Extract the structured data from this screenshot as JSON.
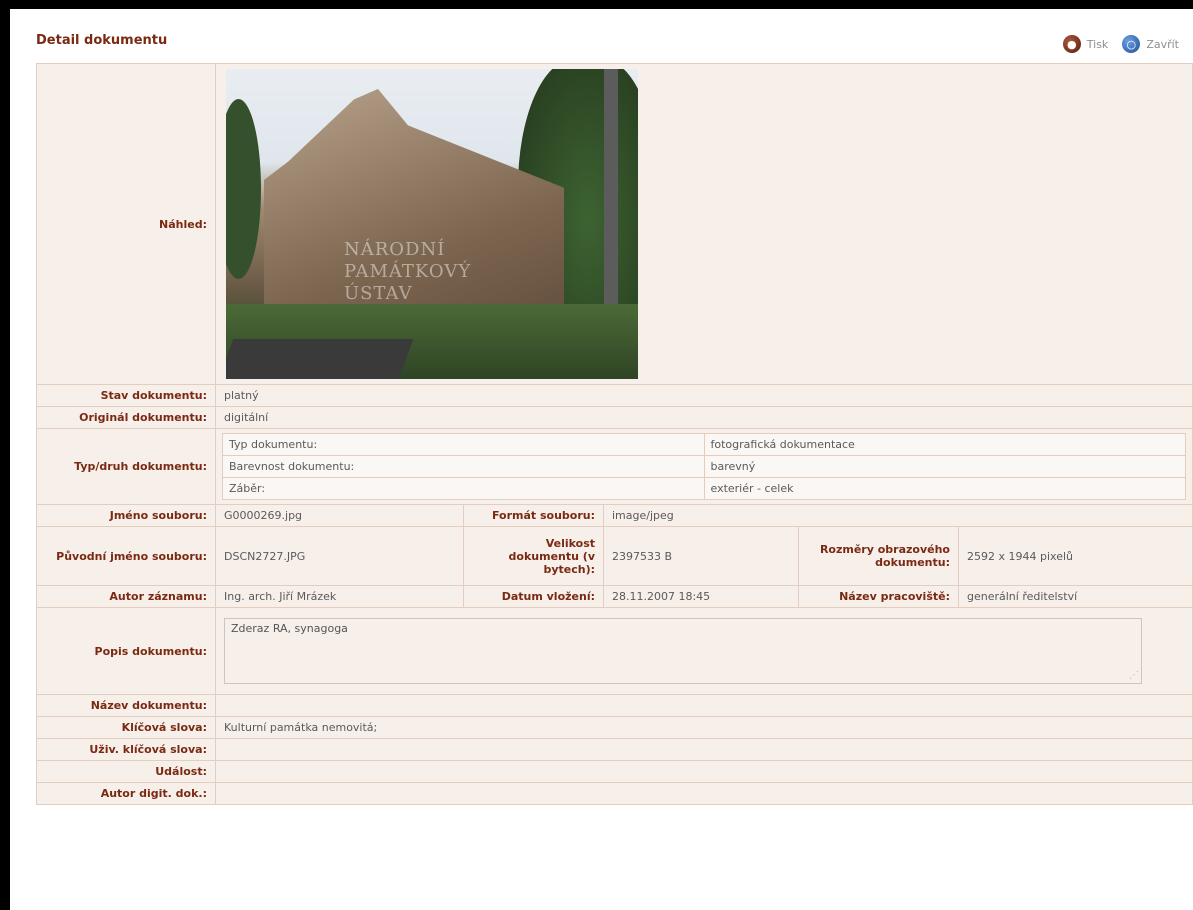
{
  "header": {
    "title": "Detail dokumentu",
    "print_label": "Tisk",
    "close_label": "Zavřít"
  },
  "preview": {
    "label": "Náhled:",
    "watermark": [
      "NÁRODNÍ",
      "PAMÁTKOVÝ",
      "ÚSTAV"
    ]
  },
  "rows": {
    "stav": {
      "label": "Stav dokumentu:",
      "value": "platný"
    },
    "original": {
      "label": "Originál dokumentu:",
      "value": "digitální"
    },
    "typ": {
      "label": "Typ/druh dokumentu:",
      "items": [
        {
          "key": "Typ dokumentu:",
          "value": "fotografická dokumentace"
        },
        {
          "key": "Barevnost dokumentu:",
          "value": "barevný"
        },
        {
          "key": "Záběr:",
          "value": "exteriér - celek"
        }
      ]
    },
    "jmeno": {
      "label": "Jméno souboru:",
      "value": "G0000269.jpg",
      "format_label": "Formát souboru:",
      "format_value": "image/jpeg"
    },
    "puvodni": {
      "label": "Původní jméno souboru:",
      "value": "DSCN2727.JPG",
      "size_label": "Velikost dokumentu (v bytech):",
      "size_value": "2397533 B",
      "dims_label": "Rozměry obrazového dokumentu:",
      "dims_value": "2592 x 1944 pixelů"
    },
    "autor": {
      "label": "Autor záznamu:",
      "value": "Ing. arch. Jiří Mrázek",
      "date_label": "Datum vložení:",
      "date_value": "28.11.2007 18:45",
      "workplace_label": "Název pracoviště:",
      "workplace_value": "generální ředitelství"
    },
    "popis": {
      "label": "Popis dokumentu:",
      "value": "Zderaz RA, synagoga"
    },
    "nazev": {
      "label": "Název dokumentu:",
      "value": ""
    },
    "klic": {
      "label": "Klíčová slova:",
      "value": "Kulturní památka nemovitá;"
    },
    "uziv": {
      "label": "Uživ. klíčová slova:",
      "value": ""
    },
    "udalost": {
      "label": "Událost:",
      "value": ""
    },
    "autor_digit": {
      "label": "Autor digit. dok.:",
      "value": ""
    }
  }
}
